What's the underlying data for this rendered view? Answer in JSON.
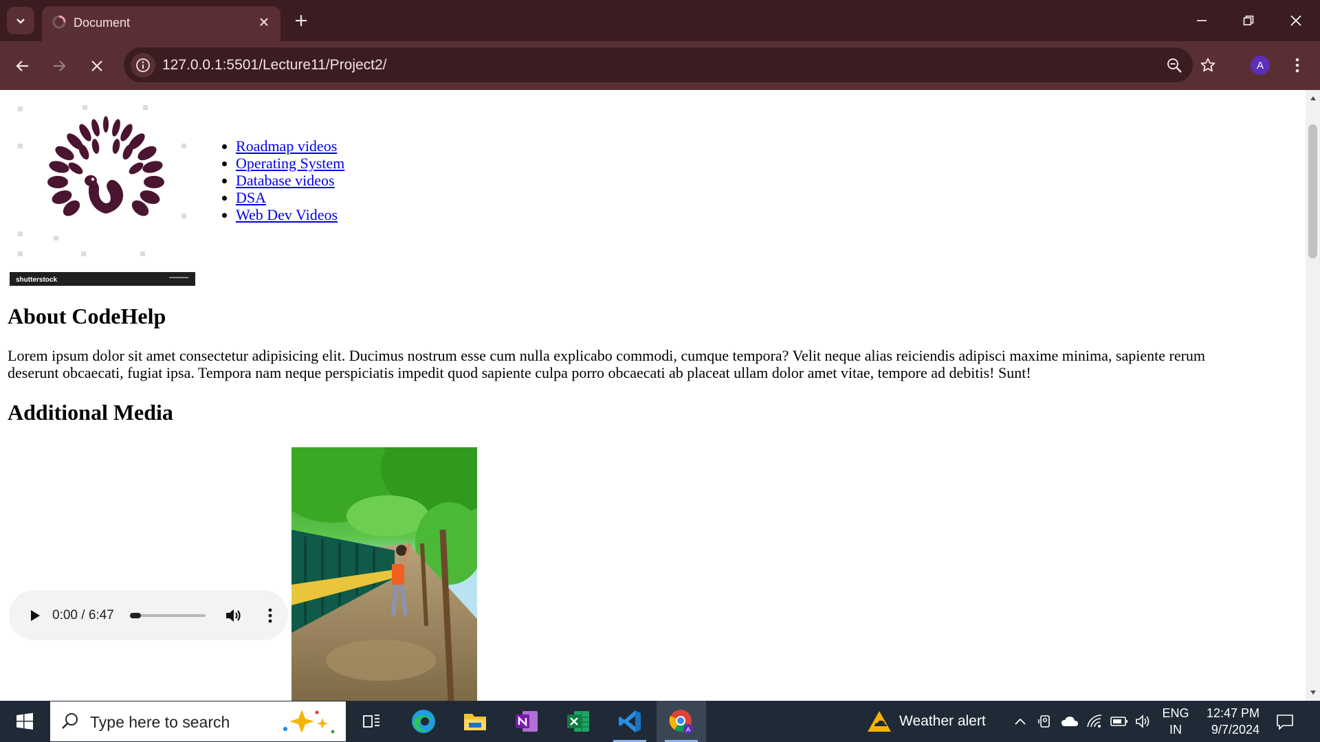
{
  "browser": {
    "tab_title": "Document",
    "url": "127.0.0.1:5501/Lecture11/Project2/",
    "profile_initial": "A",
    "theme": {
      "frame": "#3b1c20",
      "toolbar": "#5a2f34",
      "accent": "#5b2fb8"
    }
  },
  "page": {
    "logo_watermark": "shutterstock",
    "nav_links": [
      {
        "label": "Roadmap videos"
      },
      {
        "label": "Operating System"
      },
      {
        "label": "Database videos"
      },
      {
        "label": "DSA"
      },
      {
        "label": "Web Dev Videos"
      }
    ],
    "about_heading": "About CodeHelp",
    "about_text": "Lorem ipsum dolor sit amet consectetur adipisicing elit. Ducimus nostrum esse cum nulla explicabo commodi, cumque tempora? Velit neque alias reiciendis adipisci maxime minima, sapiente rerum deserunt obcaecati, fugiat ipsa. Tempora nam neque perspiciatis impedit quod sapiente culpa porro obcaecati ab placeat ullam dolor amet vitae, tempore ad debitis! Sunt!",
    "media_heading": "Additional Media",
    "audio": {
      "time": "0:00 / 6:47",
      "progress": 0
    }
  },
  "taskbar": {
    "search_placeholder": "Type here to search",
    "weather": "Weather alert",
    "lang_top": "ENG",
    "lang_bottom": "IN",
    "time": "12:47 PM",
    "date": "9/7/2024",
    "pinned_apps": [
      "task-view",
      "edge",
      "file-explorer",
      "onenote",
      "excel",
      "vscode",
      "chrome"
    ]
  }
}
